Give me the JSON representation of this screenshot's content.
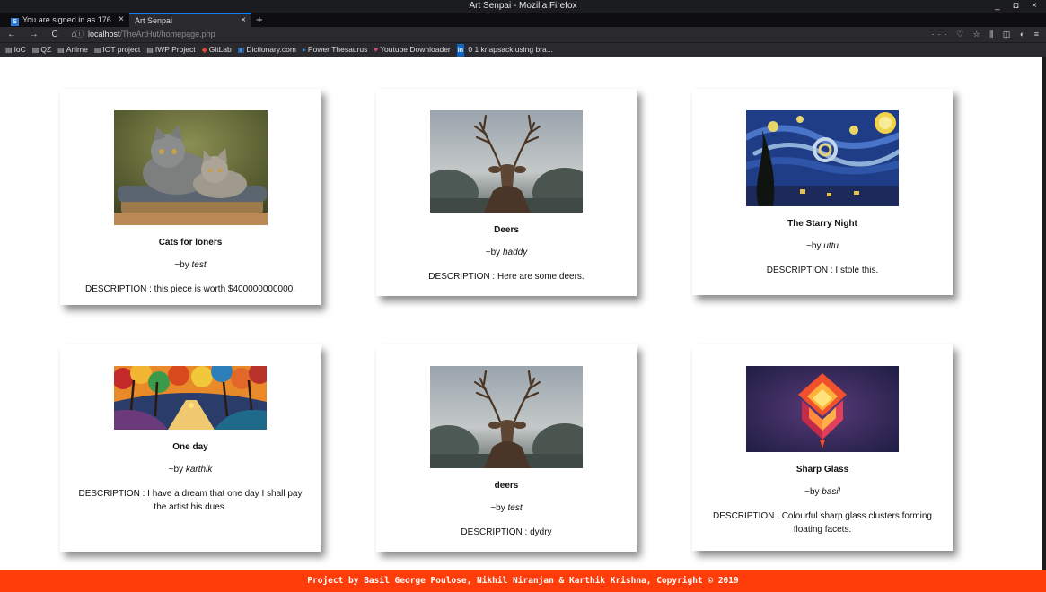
{
  "window": {
    "title": "Art Senpai - Mozilla Firefox",
    "controls": "_ ◘ ×"
  },
  "tabs": [
    {
      "label": "You are signed in as 176",
      "close": "×",
      "favicon": "S"
    },
    {
      "label": "Art Senpai",
      "close": "×"
    }
  ],
  "newtab": "+",
  "nav": {
    "buttons": "← → C ⌂",
    "url_host": "localhost",
    "url_path": "/TheArtHut/homepage.php",
    "tools": "··· ♡ ☆ ⫼ ◫ ◐ ≡"
  },
  "bookmarks": [
    {
      "label": "IoC",
      "icon": "folder-icon"
    },
    {
      "label": "QZ",
      "icon": "folder-icon"
    },
    {
      "label": "Anime",
      "icon": "folder-icon"
    },
    {
      "label": "IOT project",
      "icon": "folder-icon"
    },
    {
      "label": "IWP Project",
      "icon": "folder-icon"
    },
    {
      "label": "GitLab",
      "icon": "gitlab-icon"
    },
    {
      "label": "Dictionary.com",
      "icon": "dictionary-icon"
    },
    {
      "label": "Power Thesaurus",
      "icon": "thesaurus-icon"
    },
    {
      "label": "Youtube Downloader",
      "icon": "heart-icon"
    },
    {
      "label": "0 1 knapsack using bra...",
      "icon": "linkedin-icon"
    }
  ],
  "cards": [
    {
      "title": "Cats for loners",
      "by_prefix": "~by",
      "author": "test",
      "description": "DESCRIPTION : this piece is worth $400000000000."
    },
    {
      "title": "Deers",
      "by_prefix": "~by",
      "author": "haddy",
      "description": "DESCRIPTION : Here are some deers."
    },
    {
      "title": "The Starry Night",
      "by_prefix": "~by",
      "author": "uttu",
      "description": "DESCRIPTION : I stole this."
    },
    {
      "title": "One day",
      "by_prefix": "~by",
      "author": "karthik",
      "description": "DESCRIPTION : I have a dream that one day I shall pay the artist his dues."
    },
    {
      "title": "deers",
      "by_prefix": "~by",
      "author": "test",
      "description": "DESCRIPTION : dydry"
    },
    {
      "title": "Sharp Glass",
      "by_prefix": "~by",
      "author": "basil",
      "description": "DESCRIPTION : Colourful sharp glass clusters forming floating facets."
    }
  ],
  "footer": {
    "text": "Project by Basil George Poulose, Nikhil Niranjan & Karthik Krishna, Copyright © 2019"
  },
  "colors": {
    "footer": "#ff3d0a",
    "chrome": "#2a2a2e",
    "accent": "#0a84ff"
  }
}
